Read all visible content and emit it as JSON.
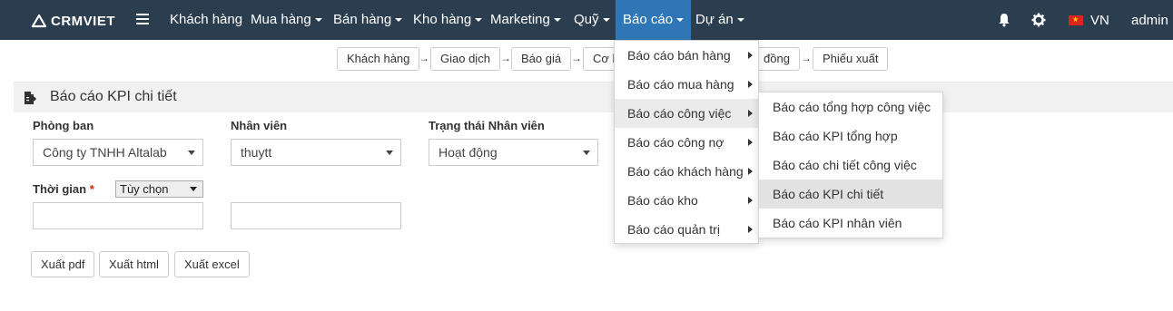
{
  "brand": {
    "name": "CRMVIET"
  },
  "nav": {
    "items": [
      {
        "label": "Khách hàng"
      },
      {
        "label": "Mua hàng"
      },
      {
        "label": "Bán hàng"
      },
      {
        "label": "Kho hàng"
      },
      {
        "label": "Marketing"
      },
      {
        "label": "Quỹ"
      },
      {
        "label": "Báo cáo"
      },
      {
        "label": "Dự án"
      }
    ],
    "lang": "VN",
    "user": "admin"
  },
  "steps": [
    {
      "label": "Khách hàng"
    },
    {
      "label": "Giao dịch"
    },
    {
      "label": "Báo giá"
    },
    {
      "label": "Cơ h"
    },
    {
      "label": "đồng"
    },
    {
      "label": "Phiếu xuất"
    }
  ],
  "page": {
    "title": "Báo cáo KPI chi tiết"
  },
  "form": {
    "department_label": "Phòng ban",
    "department_value": "Công ty TNHH Altalab",
    "staff_label": "Nhân viên",
    "staff_value": "thuytt",
    "status_label": "Trạng thái Nhân viên",
    "status_value": "Hoạt động",
    "time_label": "Thời gian",
    "time_required": "*",
    "time_mode": "Tùy chọn",
    "from_value": "",
    "to_value": ""
  },
  "buttons": {
    "pdf": "Xuất pdf",
    "html": "Xuất html",
    "excel": "Xuất excel"
  },
  "menu": {
    "items": [
      {
        "label": "Báo cáo bán hàng"
      },
      {
        "label": "Báo cáo mua hàng"
      },
      {
        "label": "Báo cáo công việc"
      },
      {
        "label": "Báo cáo công nợ"
      },
      {
        "label": "Báo cáo khách hàng"
      },
      {
        "label": "Báo cáo kho"
      },
      {
        "label": "Báo cáo quản trị"
      }
    ],
    "submenu": [
      {
        "label": "Báo cáo tổng hợp công việc"
      },
      {
        "label": "Báo cáo KPI tổng hợp"
      },
      {
        "label": "Báo cáo chi tiết công việc"
      },
      {
        "label": "Báo cáo KPI chi tiết"
      },
      {
        "label": "Báo cáo KPI nhân viên"
      }
    ]
  },
  "colors": {
    "navbar": "#2b3e50",
    "active_nav": "#2f76b6",
    "required": "#d9230f"
  },
  "icons": [
    "cloud-logo-icon",
    "hamburger-icon",
    "bell-icon",
    "gear-icon",
    "vn-flag-icon",
    "report-icon"
  ]
}
